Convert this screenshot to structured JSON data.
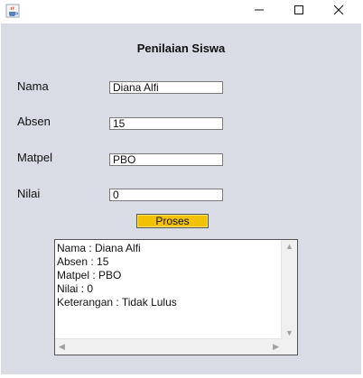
{
  "window": {
    "minimize_icon": "minimize-icon",
    "maximize_icon": "maximize-icon",
    "close_icon": "close-icon",
    "app_icon": "java-cup-icon"
  },
  "form": {
    "heading": "Penilaian Siswa",
    "fields": [
      {
        "label": "Nama",
        "value": "Diana Alfi"
      },
      {
        "label": "Absen",
        "value": "15"
      },
      {
        "label": "Matpel",
        "value": "PBO"
      },
      {
        "label": "Nilai",
        "value": "0"
      }
    ],
    "button_label": "Proses",
    "button_color": "#f2c200",
    "output_lines": [
      "Nama : Diana Alfi",
      "Absen : 15",
      "Matpel : PBO",
      "Nilai : 0",
      "Keterangan : Tidak Lulus"
    ]
  }
}
